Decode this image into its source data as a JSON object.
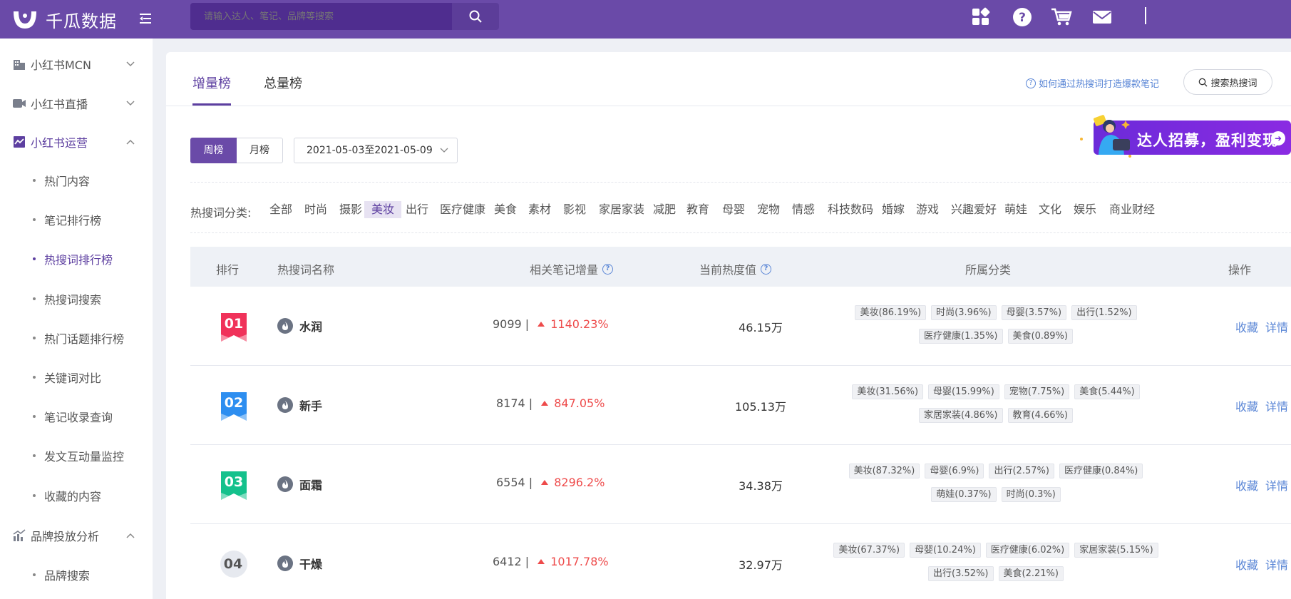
{
  "header": {
    "brand": "千瓜数据",
    "search_placeholder": "请输入达人、笔记、品牌等搜索",
    "icons": [
      "apps-grid-icon",
      "help-icon",
      "cart-icon",
      "mail-icon"
    ]
  },
  "sidebar": {
    "groups": [
      {
        "label": "小红书MCN",
        "icon": "building-icon",
        "expanded": false
      },
      {
        "label": "小红书直播",
        "icon": "video-icon",
        "expanded": false
      },
      {
        "label": "小红书运营",
        "icon": "chart-card-icon",
        "expanded": true,
        "active": true
      },
      {
        "label": "品牌投放分析",
        "icon": "trend-chart-icon",
        "expanded": true
      }
    ],
    "items": [
      {
        "label": "热门内容"
      },
      {
        "label": "笔记排行榜"
      },
      {
        "label": "热搜词排行榜",
        "active": true
      },
      {
        "label": "热搜词搜索"
      },
      {
        "label": "热门话题排行榜"
      },
      {
        "label": "关键词对比"
      },
      {
        "label": "笔记收录查询"
      },
      {
        "label": "发文互动量监控"
      },
      {
        "label": "收藏的内容"
      }
    ],
    "sub_items": [
      {
        "label": "品牌搜索"
      }
    ]
  },
  "tabs": [
    {
      "label": "增量榜",
      "active": true
    },
    {
      "label": "总量榜"
    }
  ],
  "help_link": "如何通过热搜词打造爆款笔记",
  "search_hot_button": "搜索热搜词",
  "period": {
    "weekly": "周榜",
    "monthly": "月榜",
    "selected": "周榜"
  },
  "date_range": "2021-05-03至2021-05-09",
  "banner_text": "达人招募，盈利变现",
  "categories": {
    "label": "热搜词分类:",
    "items": [
      "全部",
      "时尚",
      "摄影",
      "美妆",
      "出行",
      "医疗健康",
      "美食",
      "素材",
      "影视",
      "家居家装",
      "减肥",
      "教育",
      "母婴",
      "宠物",
      "情感",
      "科技数码",
      "婚嫁",
      "游戏",
      "兴趣爱好",
      "萌娃",
      "文化",
      "娱乐",
      "商业财经"
    ],
    "selected": "美妆"
  },
  "table": {
    "headers": {
      "rank": "排行",
      "name": "热搜词名称",
      "notes": "相关笔记增量",
      "heat": "当前热度值",
      "category": "所属分类",
      "ops": "操作"
    },
    "rows": [
      {
        "rank": "01",
        "keyword": "水润",
        "notes": "9099",
        "growth": "1140.23%",
        "heat": "46.15万",
        "tags": [
          "美妆(86.19%)",
          "时尚(3.96%)",
          "母婴(3.57%)",
          "出行(1.52%)",
          "医疗健康(1.35%)",
          "美食(0.89%)"
        ],
        "rank_color": "#f0325a"
      },
      {
        "rank": "02",
        "keyword": "新手",
        "notes": "8174",
        "growth": "847.05%",
        "heat": "105.13万",
        "tags": [
          "美妆(31.56%)",
          "母婴(15.99%)",
          "宠物(7.75%)",
          "美食(5.44%)",
          "家居家装(4.86%)",
          "教育(4.66%)"
        ],
        "rank_color": "#2d8ef0"
      },
      {
        "rank": "03",
        "keyword": "面霜",
        "notes": "6554",
        "growth": "8296.2%",
        "heat": "34.38万",
        "tags": [
          "美妆(87.32%)",
          "母婴(6.9%)",
          "出行(2.57%)",
          "医疗健康(0.84%)",
          "萌娃(0.37%)",
          "时尚(0.3%)"
        ],
        "rank_color": "#14c18c"
      },
      {
        "rank": "04",
        "keyword": "干燥",
        "notes": "6412",
        "growth": "1017.78%",
        "heat": "32.97万",
        "tags": [
          "美妆(67.37%)",
          "母婴(10.24%)",
          "医疗健康(6.02%)",
          "家居家装(5.15%)",
          "出行(3.52%)",
          "美食(2.21%)"
        ],
        "rank_color": null
      }
    ],
    "op_labels": {
      "collect": "收藏",
      "detail": "详情"
    }
  },
  "colors": {
    "brand": "#6a4aa8",
    "accent": "#5d3fa0",
    "link": "#5a86d6",
    "up": "#ee4b4b"
  }
}
